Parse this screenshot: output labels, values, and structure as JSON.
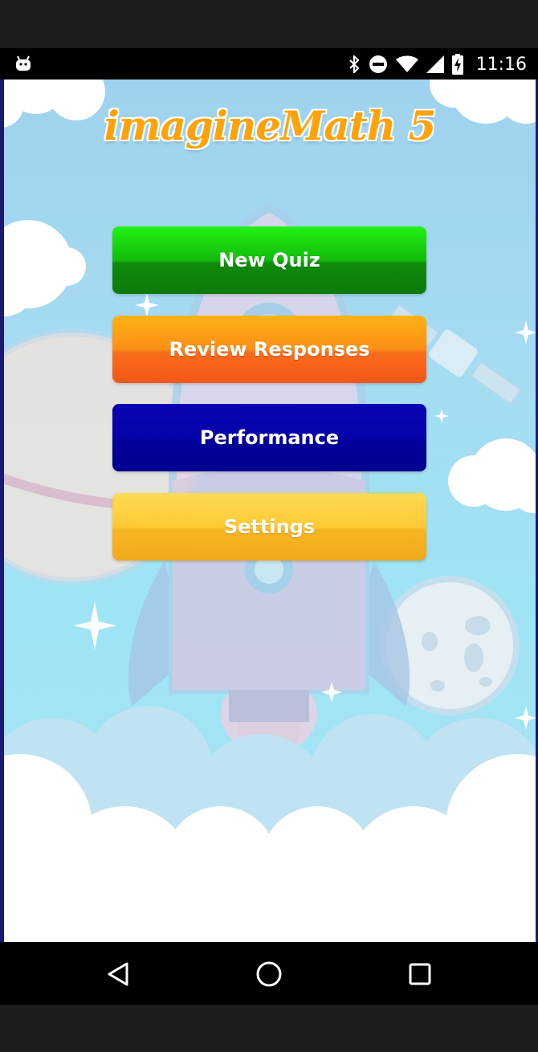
{
  "status_bar": {
    "time": "11:16",
    "icons": [
      "android-icon",
      "bluetooth-icon",
      "do-not-disturb-icon",
      "wifi-icon",
      "signal-icon",
      "battery-charging-icon"
    ]
  },
  "app": {
    "title": "imagineMath 5",
    "menu": {
      "new_quiz": "New Quiz",
      "review_responses": "Review Responses",
      "performance": "Performance",
      "settings": "Settings"
    },
    "colors": {
      "new_quiz": "#12bb0c",
      "review_responses": "#f86c1a",
      "performance": "#0402a8",
      "settings": "#fdc935",
      "title": "#ffa20a"
    }
  },
  "nav_bar": {
    "icons": [
      "back-icon",
      "home-icon",
      "recents-icon"
    ]
  }
}
